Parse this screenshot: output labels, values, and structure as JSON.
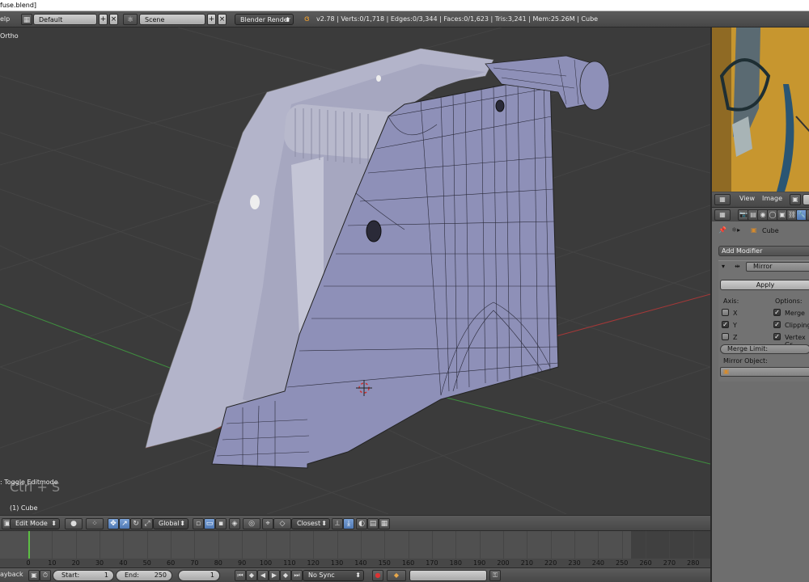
{
  "window": {
    "title": "fuse.blend]"
  },
  "info_bar": {
    "help_menu": "elp",
    "screen_layout": "Default",
    "scene": "Scene",
    "render_engine": "Blender Render",
    "stats": "v2.78 | Verts:0/1,718 | Edges:0/3,344 | Faces:0/1,623 | Tris:3,241 | Mem:25.26M | Cube"
  },
  "viewport": {
    "view_label": "Ortho",
    "object_label": "(1) Cube",
    "hud_shortcut": "Ctrl + S",
    "operator_last": ": Toggle Editmode"
  },
  "viewport_header": {
    "mode": "Edit Mode",
    "orientation": "Global",
    "snap_target": "Closest"
  },
  "timeline": {
    "current_frame": 1,
    "ticks": [
      "0",
      "10",
      "20",
      "30",
      "40",
      "50",
      "60",
      "70",
      "80",
      "90",
      "100",
      "110",
      "120",
      "130",
      "140",
      "150",
      "160",
      "170",
      "180",
      "190",
      "200",
      "210",
      "220",
      "230",
      "240",
      "250",
      "260",
      "270",
      "280"
    ]
  },
  "playback_bar": {
    "playback_menu": "ayback",
    "start_label": "Start:",
    "start_value": "1",
    "end_label": "End:",
    "end_value": "250",
    "frame_value": "1",
    "sync_mode": "No Sync"
  },
  "image_editor": {
    "view_menu": "View",
    "image_menu": "Image"
  },
  "properties": {
    "breadcrumb_object": "Cube",
    "add_modifier": "Add Modifier",
    "modifier_name": "Mirror",
    "apply_button": "Apply",
    "axis_label": "Axis:",
    "options_label": "Options:",
    "axis_x": "X",
    "axis_y": "Y",
    "axis_z": "Z",
    "opt_merge": "Merge",
    "opt_clipping": "Clipping",
    "opt_vertex_groups": "Vertex Gr",
    "merge_limit": "Merge Limit:",
    "mirror_object": "Mirror Object:"
  },
  "checkboxes": {
    "x": false,
    "y": true,
    "z": false,
    "merge": true,
    "clipping": true,
    "vertex_groups": true
  },
  "colors": {
    "grid_red": "#b03a3a",
    "grid_green": "#3f8f3f",
    "frame_marker": "#5cbf44",
    "mesh": "#8e90b8"
  }
}
